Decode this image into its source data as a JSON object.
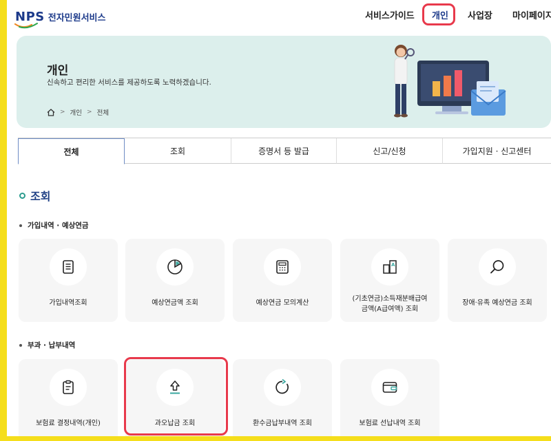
{
  "header": {
    "logo_mark": "NPS",
    "logo_service": "전자민원서비스",
    "nav": [
      "서비스가이드",
      "개인",
      "사업장",
      "마이페이지"
    ]
  },
  "hero": {
    "title": "개인",
    "subtitle": "신속하고 편리한 서비스를 제공하도록 노력하겠습니다.",
    "breadcrumb": [
      "개인",
      "전체"
    ]
  },
  "tabs": [
    "전체",
    "조회",
    "증명서 등 발급",
    "신고/신청",
    "가입지원 · 신고센터"
  ],
  "section": {
    "title": "조회",
    "groups": [
      {
        "title": "가입내역 · 예상연금",
        "cards": [
          {
            "label": "가입내역조회",
            "icon": "document-list-icon"
          },
          {
            "label": "예상연금액 조회",
            "icon": "pie-chart-icon"
          },
          {
            "label": "예상연금 모의계산",
            "icon": "calculator-icon"
          },
          {
            "label": "(기초연금)소득재분배급여\n금액(A급여액) 조회",
            "icon": "compare-a-icon"
          },
          {
            "label": "장애·유족 예상연금 조회",
            "icon": "magnifier-icon"
          }
        ]
      },
      {
        "title": "부과 · 납부내역",
        "cards": [
          {
            "label": "보험료 결정내역(개인)",
            "icon": "clipboard-icon"
          },
          {
            "label": "과오납금 조회",
            "icon": "upload-arrow-icon"
          },
          {
            "label": "환수금납부내역 조회",
            "icon": "refresh-icon"
          },
          {
            "label": "보험료 선납내역 조회",
            "icon": "wallet-icon"
          }
        ]
      }
    ]
  },
  "colors": {
    "brand_navy": "#1c3a8a",
    "accent_teal": "#2a9b8e",
    "hero_bg": "#dcefec",
    "highlight_red": "#e8394b",
    "frame_yellow": "#f5de1b"
  }
}
